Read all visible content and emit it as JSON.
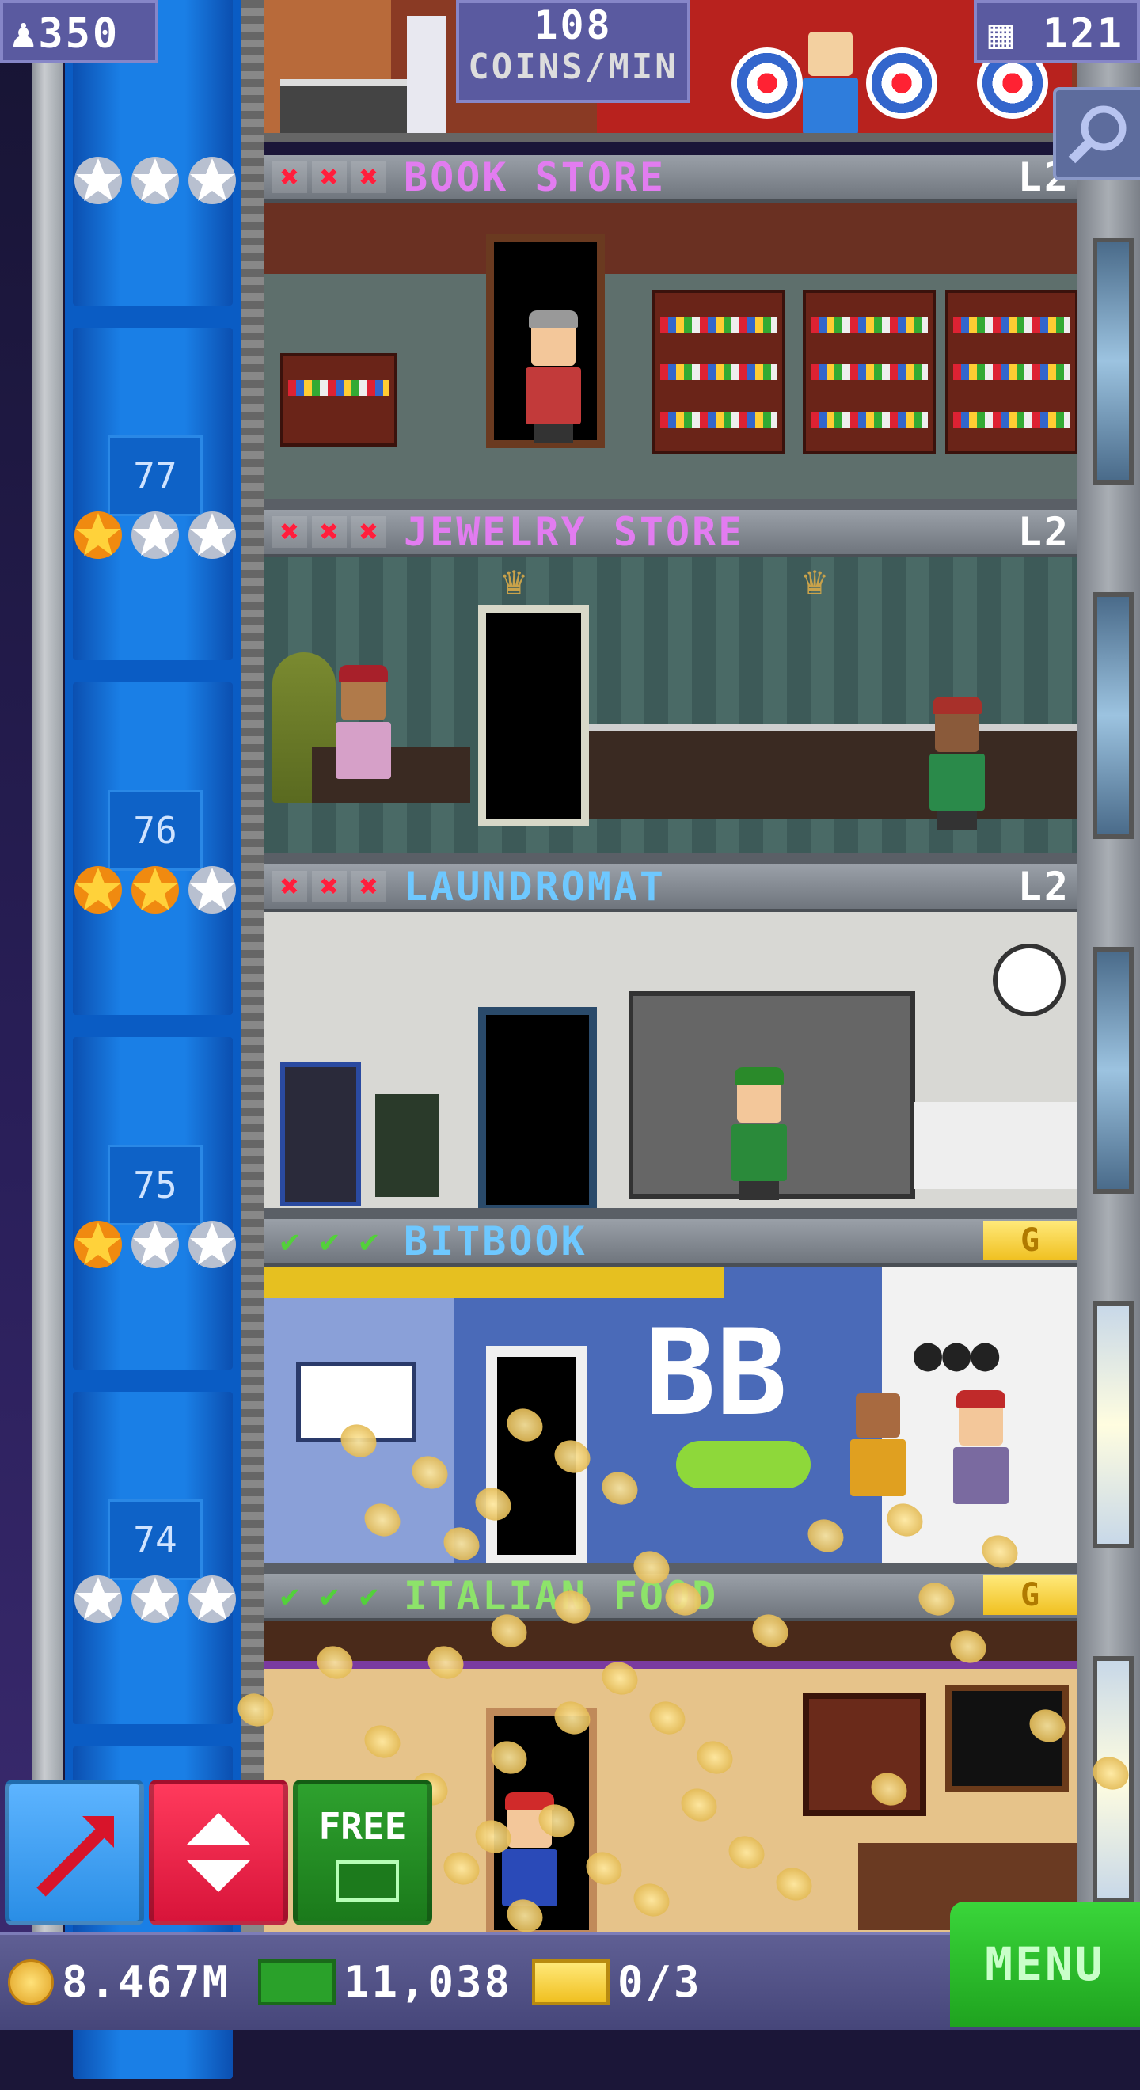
{
  "hud": {
    "population": "350",
    "coins_rate_value": "108",
    "coins_rate_unit": "COINS/MIN",
    "floors_count": "121"
  },
  "floors": [
    {
      "name": "BOOK STORE",
      "level": "L2",
      "floor_number": "77",
      "stars_filled": 0,
      "title_color": "#e27cf0",
      "marks": "x"
    },
    {
      "name": "JEWELRY STORE",
      "level": "L2",
      "floor_number": "76",
      "stars_filled": 1,
      "title_color": "#e27cf0",
      "marks": "x"
    },
    {
      "name": "LAUNDROMAT",
      "level": "L2",
      "floor_number": "75",
      "stars_filled": 2,
      "title_color": "#6ec8ff",
      "marks": "x"
    },
    {
      "name": "BITBOOK",
      "badge": "G",
      "floor_number": "74",
      "stars_filled": 1,
      "title_color": "#6ec8ff",
      "marks": "check"
    },
    {
      "name": "ITALIAN FOOD",
      "badge": "G",
      "stars_filled": 0,
      "title_color": "#8de36a",
      "marks": "check"
    }
  ],
  "bitbook_sign": "BB",
  "buttons": {
    "free_label": "FREE",
    "menu_label": "MENU"
  },
  "bottom_bar": {
    "coins": "8.467M",
    "bux": "11,038",
    "tickets": "0/3"
  },
  "colors": {
    "shaft_blue": "#0a5cc4",
    "hud_purple": "#5a5aa0",
    "menu_green": "#2ec42e",
    "build_blue": "#3aa0f5",
    "elevator_red": "#ee2a4c",
    "free_green": "#23902a"
  },
  "icons": {
    "population": "person-icon",
    "floors": "building-icon",
    "search": "magnifier-icon",
    "build": "arrow-up-right-icon",
    "elevator": "up-down-arrows-icon",
    "coins": "coin-icon",
    "bux": "cash-icon",
    "tickets": "ticket-icon"
  }
}
